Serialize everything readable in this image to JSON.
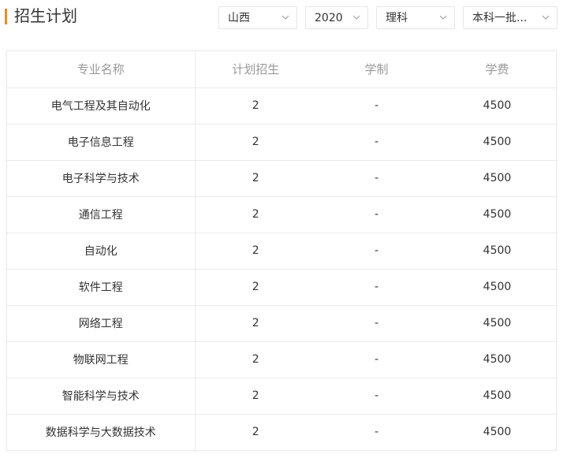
{
  "header": {
    "title": "招生计划"
  },
  "filters": {
    "province": "山西",
    "year": "2020",
    "category": "理科",
    "batch": "本科一批..."
  },
  "table": {
    "columns": [
      "专业名称",
      "计划招生",
      "学制",
      "学费"
    ],
    "rows": [
      [
        "电气工程及其自动化",
        "2",
        "-",
        "4500"
      ],
      [
        "电子信息工程",
        "2",
        "-",
        "4500"
      ],
      [
        "电子科学与技术",
        "2",
        "-",
        "4500"
      ],
      [
        "通信工程",
        "2",
        "-",
        "4500"
      ],
      [
        "自动化",
        "2",
        "-",
        "4500"
      ],
      [
        "软件工程",
        "2",
        "-",
        "4500"
      ],
      [
        "网络工程",
        "2",
        "-",
        "4500"
      ],
      [
        "物联网工程",
        "2",
        "-",
        "4500"
      ],
      [
        "智能科学与技术",
        "2",
        "-",
        "4500"
      ],
      [
        "数据科学与大数据技术",
        "2",
        "-",
        "4500"
      ]
    ]
  },
  "colors": {
    "accent": "#e88a2d",
    "border": "#ebebeb",
    "header_text": "#999999"
  }
}
